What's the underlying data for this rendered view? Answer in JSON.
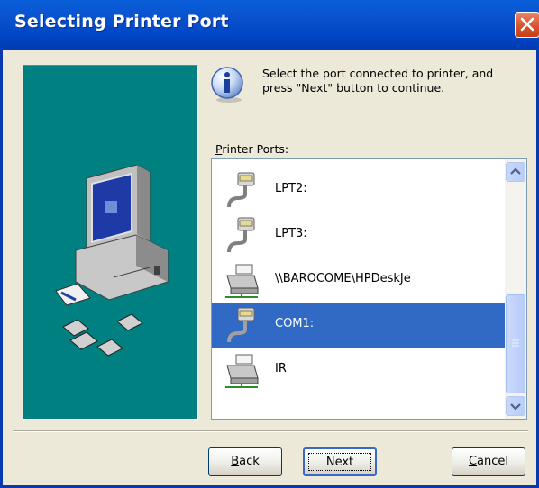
{
  "window": {
    "title": "Selecting Printer Port"
  },
  "instruction": {
    "line1": "Select the port connected to printer, and",
    "line2": "press \"Next\" button to continue."
  },
  "ports": {
    "label_accel": "P",
    "label_rest": "rinter Ports:",
    "items": [
      {
        "label": "LPT2:",
        "icon": "parallel-port-icon",
        "selected": false
      },
      {
        "label": "LPT3:",
        "icon": "parallel-port-icon",
        "selected": false
      },
      {
        "label": "\\\\BAROCOME\\HPDeskJe",
        "icon": "network-printer-icon",
        "selected": false
      },
      {
        "label": "COM1:",
        "icon": "serial-port-icon",
        "selected": true
      },
      {
        "label": "IR",
        "icon": "infrared-printer-icon",
        "selected": false
      }
    ]
  },
  "buttons": {
    "back_accel": "B",
    "back_rest": "ack",
    "next": "Next",
    "cancel_accel": "C",
    "cancel_rest": "ancel"
  },
  "colors": {
    "titlebar": "#0a54d0",
    "art_background": "#008080",
    "selection": "#316ac5",
    "dialog": "#ece9d8"
  }
}
